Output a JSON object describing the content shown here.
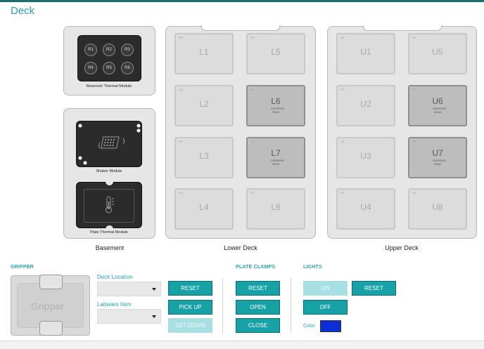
{
  "page": {
    "title": "Deck"
  },
  "basement": {
    "label": "Basement",
    "reservoir": {
      "label": "Reservoir Thermal Module",
      "wells": [
        "R1",
        "R2",
        "R3",
        "R4",
        "R5",
        "R6"
      ]
    },
    "shaker": {
      "label": "Shaker Module"
    },
    "plate_thermal": {
      "label": "Plate Thermal Module"
    }
  },
  "lower_deck": {
    "label": "Lower Deck",
    "slots": [
      {
        "corner": "A1",
        "name": "L1",
        "sub": "",
        "active": false
      },
      {
        "corner": "A1",
        "name": "L5",
        "sub": "",
        "active": false
      },
      {
        "corner": "A1",
        "name": "L2",
        "sub": "",
        "active": false
      },
      {
        "corner": "A1",
        "name": "L6",
        "sub": "DISPENSE HEAD",
        "active": true
      },
      {
        "corner": "A1",
        "name": "L3",
        "sub": "",
        "active": false
      },
      {
        "corner": "A1",
        "name": "L7",
        "sub": "DISPENSE HEAD",
        "active": true
      },
      {
        "corner": "A1",
        "name": "L4",
        "sub": "",
        "active": false
      },
      {
        "corner": "A1",
        "name": "L8",
        "sub": "",
        "active": false
      }
    ]
  },
  "upper_deck": {
    "label": "Upper Deck",
    "slots": [
      {
        "corner": "A1",
        "name": "U1",
        "sub": "",
        "active": false
      },
      {
        "corner": "A1",
        "name": "U5",
        "sub": "",
        "active": false
      },
      {
        "corner": "A1",
        "name": "U2",
        "sub": "",
        "active": false
      },
      {
        "corner": "A1",
        "name": "U6",
        "sub": "DISPENSE HEAD",
        "active": true
      },
      {
        "corner": "A1",
        "name": "U3",
        "sub": "",
        "active": false
      },
      {
        "corner": "A1",
        "name": "U7",
        "sub": "DISPENSE HEAD",
        "active": true
      },
      {
        "corner": "A1",
        "name": "U4",
        "sub": "",
        "active": false
      },
      {
        "corner": "A1",
        "name": "U8",
        "sub": "",
        "active": false
      }
    ]
  },
  "gripper": {
    "title": "GRIPPER",
    "graphic_label": "Gripper",
    "deck_location_label": "Deck Location",
    "deck_location_value": "",
    "labware_item_label": "Labware Item",
    "labware_item_value": "",
    "reset": "RESET",
    "pick_up": "PICK UP",
    "set_down": "SET DOWN"
  },
  "plate_clamps": {
    "title": "PLATE CLAMPS",
    "reset": "RESET",
    "open": "OPEN",
    "close": "CLOSE"
  },
  "lights": {
    "title": "LIGHTS",
    "on": "ON",
    "off": "OFF",
    "reset": "RESET",
    "color_label": "Color",
    "color": "#0a2fd6"
  },
  "colors": {
    "accent": "#22a5b5",
    "button": "#16a2a6",
    "button_disabled": "#a8dfe2",
    "topbar": "#1a6e6e"
  }
}
